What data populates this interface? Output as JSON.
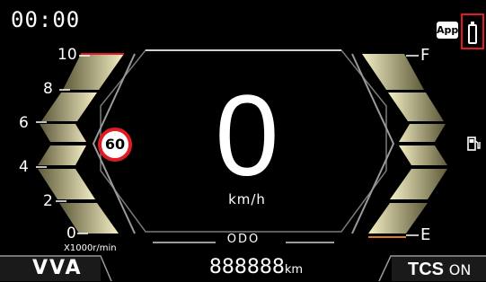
{
  "status": {
    "time": "00:00",
    "app_badge": "App",
    "battery_icon": "battery-icon"
  },
  "tachometer": {
    "labels": [
      "10",
      "8",
      "6",
      "4",
      "2",
      "0"
    ],
    "unit": "X1000r/min"
  },
  "speedometer": {
    "speed": "0",
    "unit": "km/h",
    "speed_limit": "60"
  },
  "fuel": {
    "full": "F",
    "empty": "E",
    "icon": "fuel-pump-icon"
  },
  "odometer": {
    "label": "ODO",
    "value": "888888",
    "unit": "km"
  },
  "footer": {
    "mode": "VVA",
    "tcs_label": "TCS",
    "tcs_state": "ON"
  },
  "colors": {
    "background": "#000000",
    "gauge_segment": "#d8d2a0",
    "redline": "#e01b24",
    "fuel_low": "#e07a1b",
    "frame": "#c8c8c8"
  }
}
